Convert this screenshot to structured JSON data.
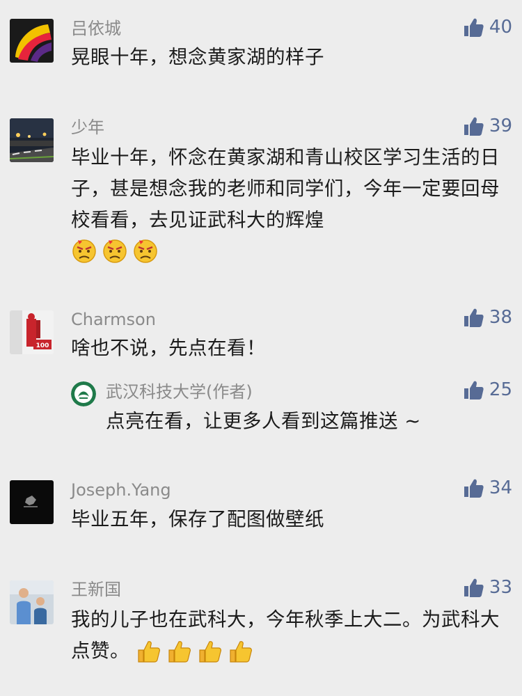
{
  "comments": [
    {
      "name": "吕依城",
      "likes": "40",
      "text": "晃眼十年，想念黄家湖的样子"
    },
    {
      "name": "少年",
      "likes": "39",
      "text": "毕业十年，怀念在黄家湖和青山校区学习生活的日子，甚是想念我的老师和同学们，今年一定要回母校看看，去见证武科大的辉煌"
    },
    {
      "name": "Charmson",
      "likes": "38",
      "text": "啥也不说，先点在看！",
      "reply": {
        "name": "武汉科技大学(作者)",
        "likes": "25",
        "text": "点亮在看，让更多人看到这篇推送 ~"
      }
    },
    {
      "name": "Joseph.Yang",
      "likes": "34",
      "text": "毕业五年，保存了配图做壁纸"
    },
    {
      "name": "王新国",
      "likes": "33",
      "text": "我的儿子也在武科大，今年秋季上大二。为武科大点赞。"
    }
  ],
  "icons": {
    "like": "thumbs-up-icon",
    "emoji_frown": "frowning-face-emoji",
    "emoji_thumbs": "thumbs-up-emoji"
  },
  "colors": {
    "background": "#ededed",
    "like_blue": "#576b95",
    "name_gray": "#8a8a8a",
    "text": "#1b1b1b"
  }
}
